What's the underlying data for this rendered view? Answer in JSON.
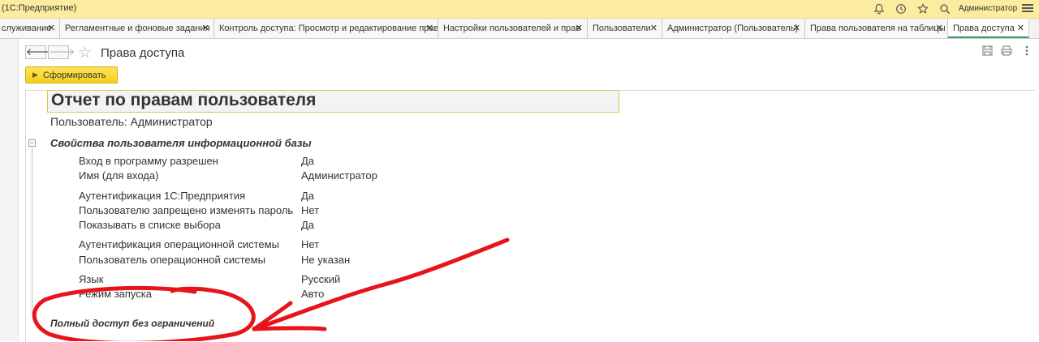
{
  "app_title": "(1С:Предприятие)",
  "user_name": "Администратор",
  "tabs": [
    {
      "label": "служивание"
    },
    {
      "label": "Регламентные и фоновые задания"
    },
    {
      "label": "Контроль доступа: Просмотр и редактирование прав"
    },
    {
      "label": "Настройки пользователей и прав"
    },
    {
      "label": "Пользователи"
    },
    {
      "label": "Администратор (Пользователь)"
    },
    {
      "label": "Права пользователя на таблицы"
    },
    {
      "label": "Права доступа"
    }
  ],
  "icons": {
    "bell": "bell-icon",
    "history": "history-icon",
    "star": "star-icon",
    "search": "search-icon",
    "menu": "menu-icon"
  },
  "page": {
    "title": "Права доступа",
    "generate_label": "Сформировать"
  },
  "report": {
    "title": "Отчет по правам пользователя",
    "user_line": "Пользователь: Администратор",
    "section_title": "Свойства пользователя информационной базы",
    "properties": [
      {
        "name": "Вход в программу разрешен",
        "value": "Да"
      },
      {
        "name": "Имя (для входа)",
        "value": "Администратор"
      },
      {
        "name": "Аутентификация 1С:Предприятия",
        "value": "Да"
      },
      {
        "name": "Пользователю запрещено изменять пароль",
        "value": "Нет"
      },
      {
        "name": "Показывать в списке выбора",
        "value": "Да"
      },
      {
        "name": "Аутентификация операционной системы",
        "value": "Нет"
      },
      {
        "name": "Пользователь операционной системы",
        "value": "Не указан"
      },
      {
        "name": "Язык",
        "value": "Русский"
      },
      {
        "name": "Режим запуска",
        "value": "Авто"
      }
    ],
    "full_access": "Полный доступ без ограничений"
  },
  "colors": {
    "title_bar": "#fbeca0",
    "generate_button": "#f5cf1c",
    "active_tab_accent": "#3a9a5a",
    "annotation": "#e8141b"
  }
}
